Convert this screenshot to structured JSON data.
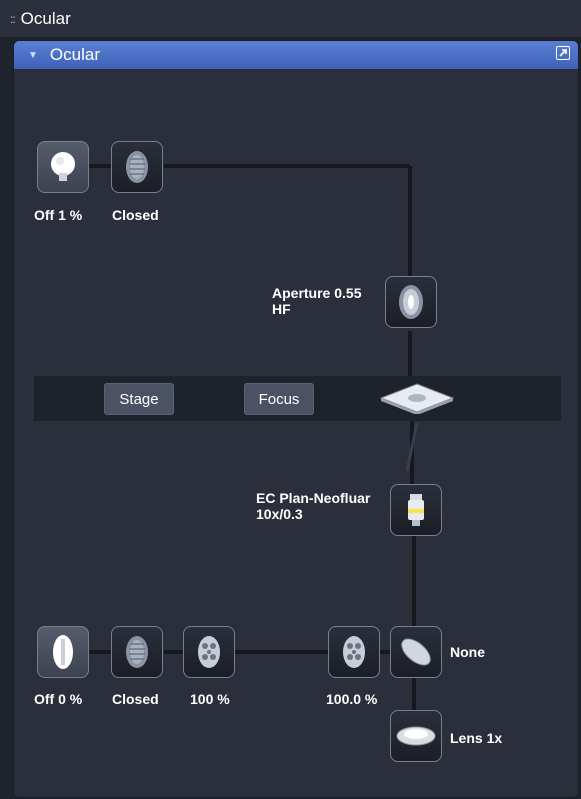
{
  "window": {
    "title": "Ocular"
  },
  "panel": {
    "title": "Ocular"
  },
  "top_path": {
    "lamp_label": "Off 1 %",
    "shutter_label": "Closed",
    "aperture_label": "Aperture 0.55",
    "aperture_sublabel": "HF"
  },
  "stage_bar": {
    "stage_button": "Stage",
    "focus_button": "Focus"
  },
  "objective": {
    "line1": "EC Plan-Neofluar",
    "line2": "10x/0.3"
  },
  "bottom_path": {
    "lamp_label": "Off 0 %",
    "shutter_label": "Closed",
    "filter1_label": "100 %",
    "filter2_label": "100.0 %",
    "reflector_label": "None",
    "tube_lens_label": "Lens 1x"
  },
  "icons": [
    "grip-icon",
    "collapse-triangle-icon",
    "undock-icon",
    "halogen-lamp-icon",
    "shutter-icon",
    "aperture-diaphragm-icon",
    "stage-icon",
    "objective-icon",
    "fluorescence-lamp-icon",
    "filter-wheel-icon",
    "reflector-icon",
    "tube-lens-icon"
  ]
}
